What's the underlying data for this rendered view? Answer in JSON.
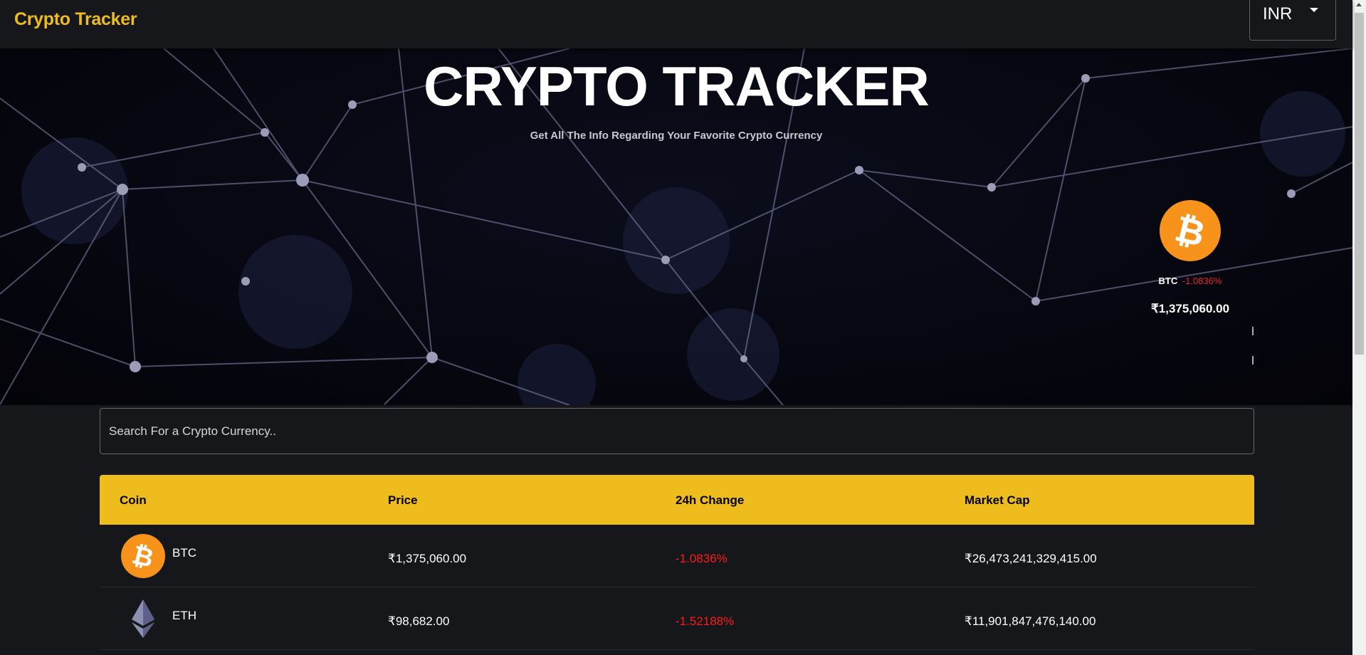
{
  "appbar": {
    "brand": "Crypto Tracker",
    "currency": "INR"
  },
  "banner": {
    "title": "CRYPTO TRACKER",
    "subtitle": "Get All The Info Regarding Your Favorite Crypto Currency",
    "carousel": [
      {
        "symbol": "BTC",
        "change": "-1.0836%",
        "price": "₹1,375,060.00",
        "icon": "bitcoin-icon"
      }
    ]
  },
  "search": {
    "placeholder": "Search For a Crypto Currency.."
  },
  "table": {
    "headers": {
      "coin": "Coin",
      "price": "Price",
      "change": "24h Change",
      "market_cap": "Market Cap"
    },
    "rows": [
      {
        "symbol": "BTC",
        "price": "₹1,375,060.00",
        "change": "-1.0836%",
        "market_cap": "₹26,473,241,329,415.00",
        "icon": "bitcoin-icon"
      },
      {
        "symbol": "ETH",
        "price": "₹98,682.00",
        "change": "-1.52188%",
        "market_cap": "₹11,901,847,476,140.00",
        "icon": "ethereum-icon"
      }
    ]
  },
  "colors": {
    "accent": "#eebc1d",
    "negative": "#ff1a1a",
    "background": "#16171a",
    "bitcoin": "#f7931a"
  }
}
